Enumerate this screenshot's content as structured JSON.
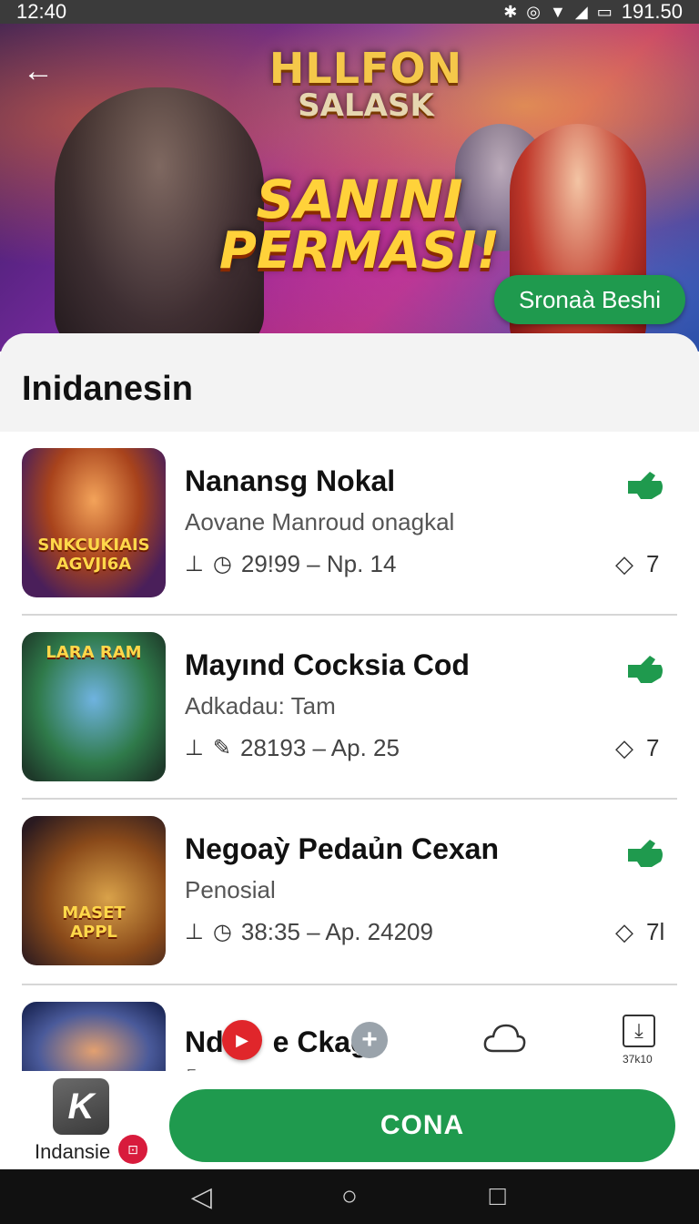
{
  "status_bar": {
    "time": "12:40",
    "battery_text": "191.50",
    "icons": [
      "bluetooth-icon",
      "nfc-icon",
      "wifi-icon",
      "signal-icon",
      "battery-icon"
    ]
  },
  "hero": {
    "logo_line1": "HLLFON",
    "logo_line2": "SALASK",
    "title_line1": "SANINI",
    "title_line2": "PERMASI!",
    "cta_label": "Sronaà Beshi"
  },
  "section": {
    "title": "Inidanesin"
  },
  "items": [
    {
      "name": "Nanansg Nokal",
      "subtitle": "Aovane Manroud onagkal",
      "meta": "29!99 – Np. 14",
      "count": "7",
      "thumb_text_1": "SNKCUKIAIS",
      "thumb_text_2": "AGVJI6A"
    },
    {
      "name": "Mayınd Cocksia Cod",
      "subtitle": "Adkadau: Tam",
      "meta": "28193 – Ap. 25",
      "count": "7",
      "thumb_text_1": "LARA RAM",
      "thumb_text_2": ""
    },
    {
      "name": "Negoaỳ Pedaủn Cexan",
      "subtitle": "Penosial",
      "meta": "38:35 – Ap. 24209",
      "count": "7l",
      "thumb_text_1": "MASET",
      "thumb_text_2": "APPL"
    }
  ],
  "partial_item": {
    "name_prefix": "Nd",
    "name_suffix": "e Ckag",
    "sub": "Ea",
    "download_label": "37k10"
  },
  "bottom_bar": {
    "app_label": "Indansie",
    "badge": "⊡",
    "primary_label": "CONA"
  },
  "colors": {
    "accent_green": "#1f9a4e",
    "badge_red": "#d81b3c"
  }
}
